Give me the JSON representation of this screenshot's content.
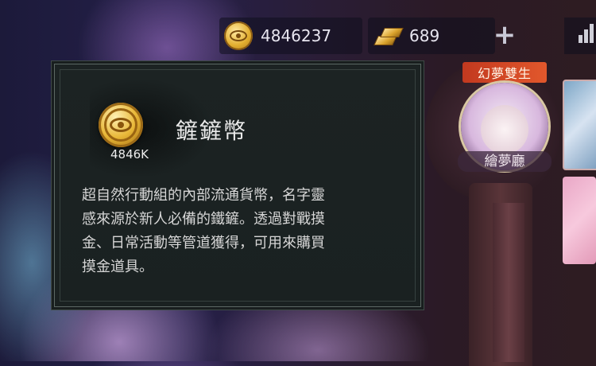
{
  "currency_bar": {
    "coin_icon": "mengjing-coin-icon",
    "coin_amount": "4846237",
    "gold_icon": "gold-bar-icon",
    "gold_amount": "689",
    "add_icon": "plus-icon"
  },
  "character": {
    "badge": "幻夢雙生",
    "name": "繪夢廳"
  },
  "tooltip": {
    "item_icon": "coin-icon",
    "item_count": "4846K",
    "item_name": "鏟鏟幣",
    "description": "超自然行動組的內部流通貨幣，名字靈\n感來源於新人必備的鐵鏟。透過對戰摸\n金、日常活動等管道獲得，可用來購買\n摸金道具。"
  },
  "colors": {
    "badge": "#d9472a",
    "tooltip_bg": "#1c2323",
    "tooltip_border": "#5c6864",
    "coin_gold": "#e2ae2f"
  }
}
